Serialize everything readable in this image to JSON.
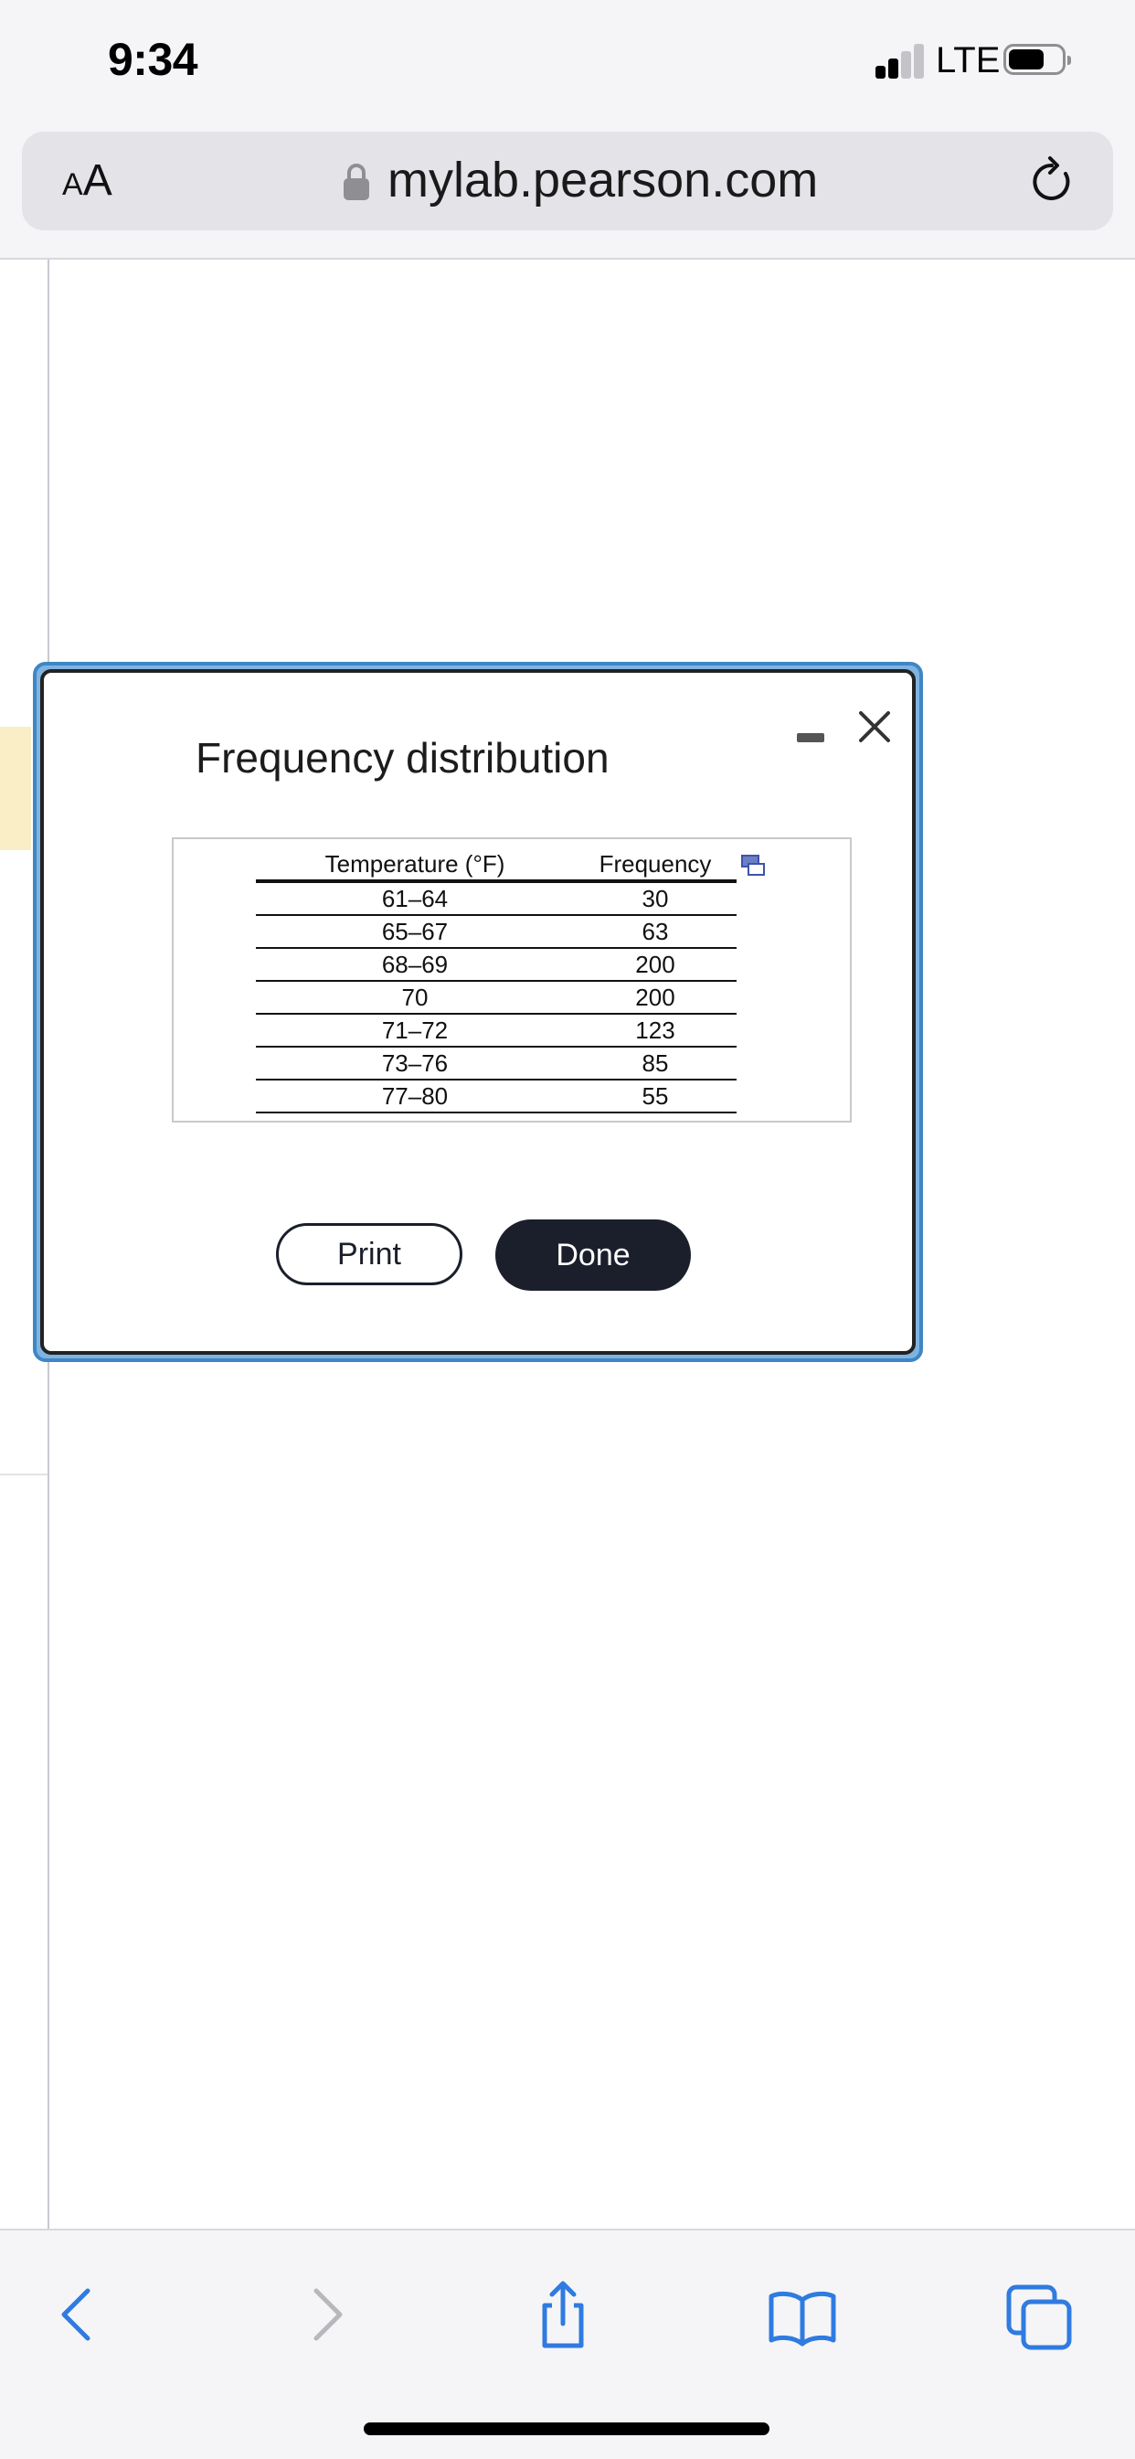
{
  "status_bar": {
    "time": "9:34",
    "network": "LTE"
  },
  "browser": {
    "text_size_label_small": "A",
    "text_size_label_large": "A",
    "url": "mylab.pearson.com"
  },
  "modal": {
    "title": "Frequency distribution",
    "table": {
      "headers": [
        "Temperature (°F)",
        "Frequency"
      ],
      "rows": [
        [
          "61–64",
          "30"
        ],
        [
          "65–67",
          "63"
        ],
        [
          "68–69",
          "200"
        ],
        [
          "70",
          "200"
        ],
        [
          "71–72",
          "123"
        ],
        [
          "73–76",
          "85"
        ],
        [
          "77–80",
          "55"
        ]
      ]
    },
    "print_label": "Print",
    "done_label": "Done"
  },
  "colors": {
    "accent_blue": "#3f86c5",
    "done_button": "#1b1f2b",
    "toolbar_icon_active": "#2f7be0",
    "toolbar_icon_disabled": "#b7b7bc"
  }
}
